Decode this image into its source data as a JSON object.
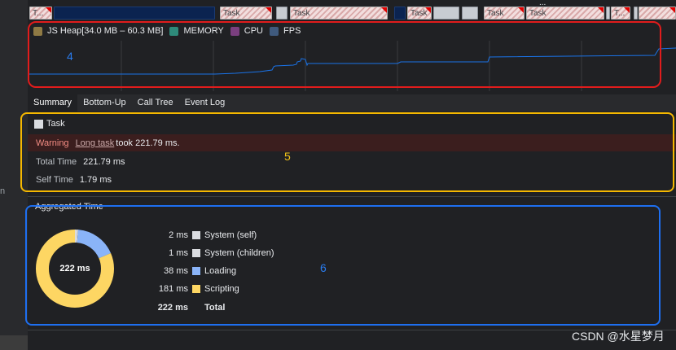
{
  "sidebar": {
    "clipped_text": "n"
  },
  "track": {
    "task_labels": [
      "T...",
      "Task",
      "Task",
      "Task",
      "Task",
      "Task",
      "T..."
    ],
    "more": "..."
  },
  "memory": {
    "legend": [
      {
        "label": "JS Heap[34.0 MB – 60.3 MB]",
        "color": "#8f7a44",
        "checked": true
      },
      {
        "label": "MEMORY",
        "color": "#2e8a7a",
        "checked": true
      },
      {
        "label": "CPU",
        "color": "#7a3f7f",
        "checked": true
      },
      {
        "label": "FPS",
        "color": "#3f5a7d",
        "checked": true
      }
    ],
    "heap_range_mb": [
      34.0,
      60.3
    ],
    "heap_line_color": "#1a73e8"
  },
  "annotations": {
    "a4": "4",
    "a5": "5",
    "a6": "6"
  },
  "tabs": [
    "Summary",
    "Bottom-Up",
    "Call Tree",
    "Event Log"
  ],
  "summary": {
    "task_title": "Task",
    "warning_label": "Warning",
    "warning_link": "Long task",
    "warning_text": "took 221.79 ms.",
    "total_time_label": "Total Time",
    "total_time_value": "221.79 ms",
    "self_time_label": "Self Time",
    "self_time_value": "1.79 ms"
  },
  "aggregated": {
    "title": "Aggregated Time",
    "total_display": "222 ms",
    "rows": [
      {
        "value": "2 ms",
        "label": "System (self)",
        "color": "#dadce0",
        "ms": 2
      },
      {
        "value": "1 ms",
        "label": "System (children)",
        "color": "#dadce0",
        "ms": 1
      },
      {
        "value": "38 ms",
        "label": "Loading",
        "color": "#8ab4f8",
        "ms": 38
      },
      {
        "value": "181 ms",
        "label": "Scripting",
        "color": "#fdd663",
        "ms": 181
      }
    ],
    "total_row": {
      "value": "222 ms",
      "label": "Total"
    }
  },
  "watermark": "CSDN @水星梦月"
}
